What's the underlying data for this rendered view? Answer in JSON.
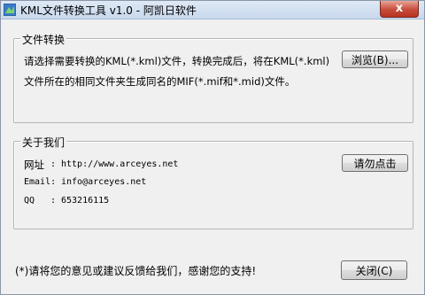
{
  "window": {
    "title": "KML文件转换工具 v1.0 - 阿凯日软件",
    "close_glyph": "x"
  },
  "convert_group": {
    "title": "文件转换",
    "line1": "请选择需要转换的KML(*.kml)文件，转换完成后，将在KML(*.kml)",
    "line2": "文件所在的相同文件夹生成同名的MIF(*.mif和*.mid)文件。",
    "browse_label": "浏览(B)..."
  },
  "about_group": {
    "title": "关于我们",
    "website_label": "网址",
    "website_sep": ":",
    "website_value": "http://www.arceyes.net",
    "email_label": "Email:",
    "email_value": "info@arceyes.net",
    "qq_label": "QQ",
    "qq_sep": ":",
    "qq_value": "653216115",
    "donate_label": "请勿点击"
  },
  "footer": {
    "note": "(*)请将您的意见或建议反馈给我们，感谢您的支持!",
    "close_label": "关闭(C)"
  },
  "icons": {
    "app": "app-icon"
  },
  "colors": {
    "close_button": "#c74b3a",
    "titlebar": "#dfe9f5"
  }
}
